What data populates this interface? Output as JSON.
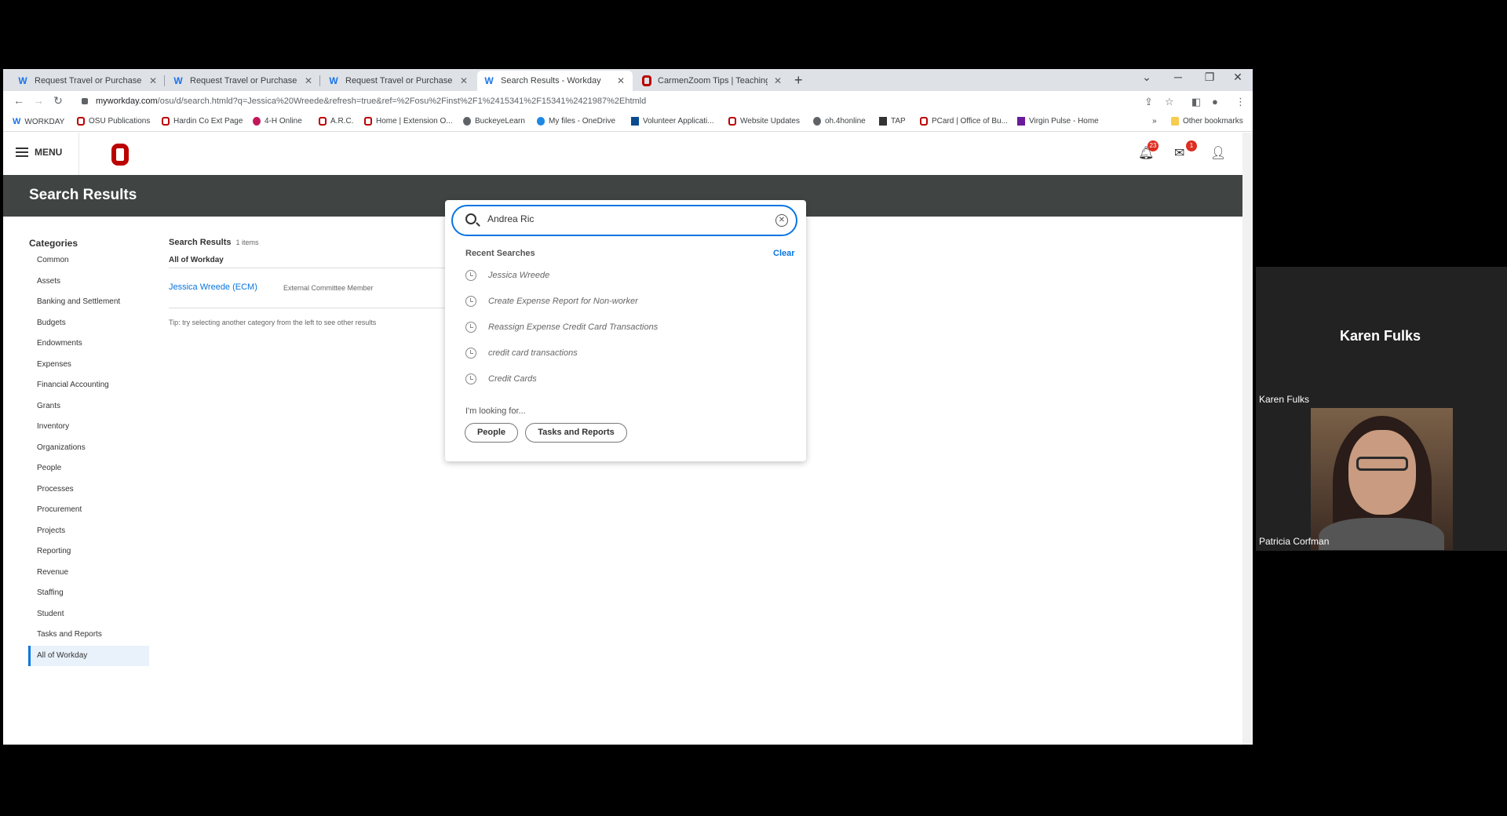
{
  "browser": {
    "tabs": [
      {
        "title": "Request Travel or Purchase - Wo",
        "favicon": "workday-icon",
        "active": false
      },
      {
        "title": "Request Travel or Purchase - Wo",
        "favicon": "workday-icon",
        "active": false
      },
      {
        "title": "Request Travel or Purchase - Wo",
        "favicon": "workday-icon",
        "active": false
      },
      {
        "title": "Search Results - Workday",
        "favicon": "workday-icon",
        "active": true
      },
      {
        "title": "CarmenZoom Tips | Teaching and",
        "favicon": "osu-icon",
        "active": false
      }
    ],
    "url_host": "myworkday.com",
    "url_path": "/osu/d/search.htmld?q=Jessica%20Wreede&refresh=true&ref=%2Fosu%2Finst%2F1%2415341%2F15341%2421987%2Ehtmld",
    "bookmarks": [
      {
        "label": "WORKDAY",
        "icon": "workday-icon"
      },
      {
        "label": "OSU Publications",
        "icon": "osu-icon"
      },
      {
        "label": "Hardin Co Ext Page",
        "icon": "osu-icon"
      },
      {
        "label": "4-H Online",
        "icon": "4h-icon"
      },
      {
        "label": "A.R.C.",
        "icon": "osu-icon"
      },
      {
        "label": "Home | Extension O...",
        "icon": "osu-icon"
      },
      {
        "label": "BuckeyeLearn",
        "icon": "globe-icon"
      },
      {
        "label": "My files - OneDrive",
        "icon": "cloud-icon"
      },
      {
        "label": "Volunteer Applicati...",
        "icon": "xm-icon"
      },
      {
        "label": "Website Updates",
        "icon": "osu-icon"
      },
      {
        "label": "oh.4honline",
        "icon": "globe-icon"
      },
      {
        "label": "TAP",
        "icon": "tap-icon"
      },
      {
        "label": "PCard | Office of Bu...",
        "icon": "osu-icon"
      },
      {
        "label": "Virgin Pulse - Home",
        "icon": "p-icon"
      }
    ],
    "more_bookmarks": "»",
    "other_bookmarks": "Other bookmarks"
  },
  "header": {
    "menu_label": "MENU",
    "notifications_count": "23",
    "inbox_count": "1"
  },
  "banner": {
    "title": "Search Results"
  },
  "categories": {
    "title": "Categories",
    "items": [
      "Common",
      "Assets",
      "Banking and Settlement",
      "Budgets",
      "Endowments",
      "Expenses",
      "Financial Accounting",
      "Grants",
      "Inventory",
      "Organizations",
      "People",
      "Processes",
      "Procurement",
      "Projects",
      "Reporting",
      "Revenue",
      "Staffing",
      "Student",
      "Tasks and Reports",
      "All of Workday"
    ],
    "selected": "All of Workday"
  },
  "results": {
    "title": "Search Results",
    "count": "1 items",
    "category": "All of Workday",
    "items": [
      {
        "name": "Jessica Wreede (ECM)",
        "type": "External Committee Member"
      }
    ],
    "tip": "Tip: try selecting another category from the left to see other results"
  },
  "search": {
    "value": "Andrea Ric",
    "recent_title": "Recent Searches",
    "clear_label": "Clear",
    "recent": [
      "Jessica Wreede",
      "Create Expense Report for Non-worker",
      "Reassign Expense Credit Card Transactions",
      "credit card transactions",
      "Credit Cards"
    ],
    "looking_for": "I'm looking for...",
    "filters": [
      "People",
      "Tasks and Reports"
    ]
  },
  "zoom": {
    "speaker": "Karen Fulks",
    "speaker_small": "Karen Fulks",
    "participant": "Patricia Corfman"
  },
  "colors": {
    "accent": "#0875e1",
    "banner": "#404544",
    "osu_red": "#bb0000",
    "badge": "#de2e21"
  }
}
